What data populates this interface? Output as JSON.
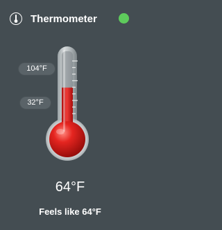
{
  "header": {
    "app_icon": "thermometer-icon",
    "title": "Thermometer",
    "status_color": "#5ecb5c"
  },
  "scale": {
    "high_label": "104°F",
    "low_label": "32°F"
  },
  "thermometer": {
    "fill_fraction": 0.57,
    "mercury_color": "#e0201e"
  },
  "reading": {
    "temperature": "64°F",
    "feels_like": "Feels like 64°F"
  }
}
